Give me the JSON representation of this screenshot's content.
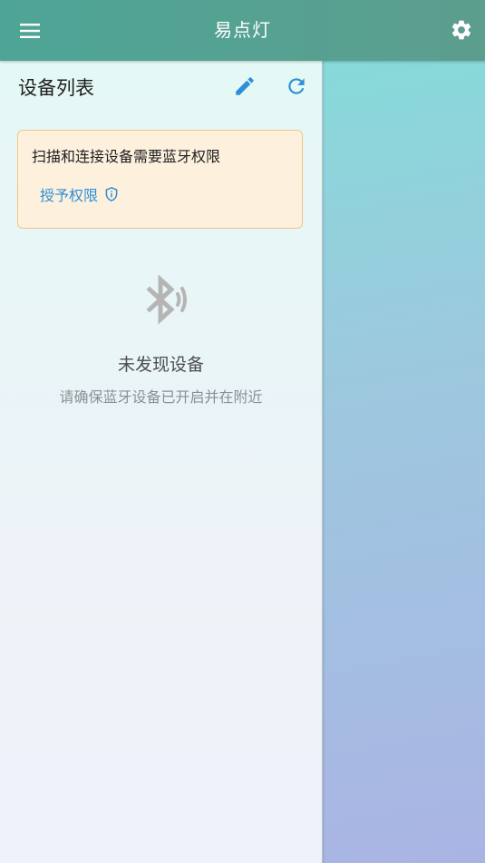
{
  "appbar": {
    "title": "易点灯",
    "menu_icon": "menu-icon",
    "settings_icon": "gear-icon"
  },
  "drawer": {
    "title": "设备列表",
    "edit_icon": "pencil-icon",
    "refresh_icon": "refresh-icon",
    "permission_card": {
      "message": "扫描和连接设备需要蓝牙权限",
      "grant_label": "授予权限",
      "grant_icon": "shield-icon"
    },
    "empty_state": {
      "icon": "bluetooth-searching-icon",
      "title": "未发现设备",
      "subtitle": "请确保蓝牙设备已开启并在附近"
    }
  },
  "colors": {
    "appbar": "#4ea596",
    "accent": "#2e8fd8",
    "card_background": "#fdf1de",
    "card_border": "#f2c584"
  }
}
